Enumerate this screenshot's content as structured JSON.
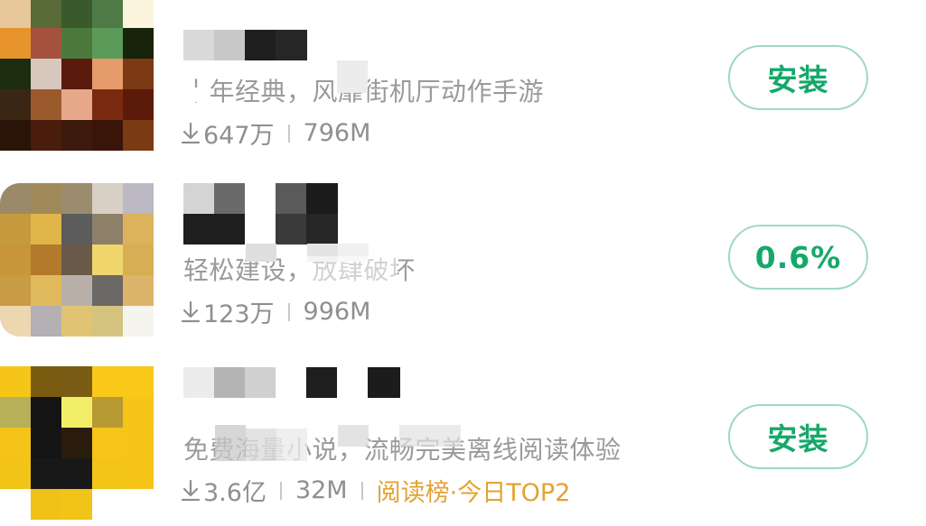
{
  "apps": [
    {
      "description": "十年经典，风靡街机厅动作手游",
      "downloads": "647万",
      "size": "796M",
      "rank": "",
      "action_label": "安装",
      "icon_pixels": [
        "#e8c79a",
        "#5a6b3a",
        "#3a5a2c",
        "#4d7a45",
        "#fbf4dc",
        "#e7942c",
        "#a4513e",
        "#4b7a3c",
        "#5c9a5a",
        "#18230c",
        "#1d2e10",
        "#d8c7bc",
        "#5b1a0c",
        "#e59b6b",
        "#7c3a14",
        "#3a2614",
        "#9a5a2c",
        "#e8a88a",
        "#7a2a10",
        "#5c1a08",
        "#2a1408",
        "#4a1c0c",
        "#3c1a0c",
        "#3a1408",
        "#7a3a14"
      ]
    },
    {
      "description": "轻松建设，放肆破坏",
      "downloads": "123万",
      "size": "996M",
      "rank": "",
      "action_label": "0.6%",
      "icon_pixels": [
        "#9a8a6a",
        "#a08a5a",
        "#9a8c6c",
        "#d8d0c4",
        "#bcb8c4",
        "#c49a3c",
        "#e0b64a",
        "#5c5c5c",
        "#8c8068",
        "#dcb25c",
        "#c8963a",
        "#b47a2c",
        "#6a5a4a",
        "#f0d66c",
        "#d8ae54",
        "#c89c44",
        "#e0ba5c",
        "#b8b0a8",
        "#6c6866",
        "#dcb46a",
        "#ecd7b0",
        "#b4b0b4",
        "#e0c474",
        "#d4c480",
        "#f6f4ee"
      ]
    },
    {
      "description": "免费海量小说，流畅完美离线阅读体验",
      "downloads": "3.6亿",
      "size": "32M",
      "rank": "阅读榜·今日TOP2",
      "action_label": "安装",
      "icon_pixels": [
        "#f5c518",
        "#7a5c10",
        "#7a5c14",
        "#fac818",
        "#fac818",
        "#b8b058",
        "#141414",
        "#f2ee68",
        "#b89a34",
        "#f6c518",
        "#f4c418",
        "#141414",
        "#2a1c0c",
        "#f6c61a",
        "#f5c518",
        "#f2c418",
        "#181818",
        "#181818",
        "#f3c518",
        "#f5c518",
        "#ffffff",
        "#f0c218",
        "#f2c418",
        "#ffffff",
        "#ffffff"
      ]
    }
  ],
  "colors": {
    "accent": "#16a86a",
    "button_border": "#9fd9bd",
    "rank": "#e3a232",
    "muted_text": "#9a9a9a"
  },
  "icons": {
    "download": "download-arrow-icon"
  }
}
